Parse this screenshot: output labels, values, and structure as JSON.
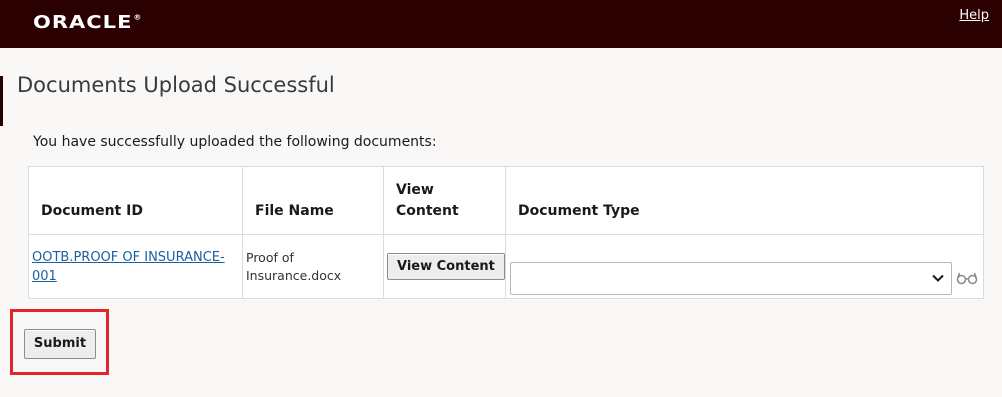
{
  "header": {
    "logo_text": "ORACLE",
    "logo_mark": "®",
    "help_label": "Help"
  },
  "page": {
    "title": "Documents Upload Successful",
    "intro": "You have successfully uploaded the following documents:"
  },
  "table": {
    "headers": {
      "document_id": "Document ID",
      "file_name": "File Name",
      "view_content_line1": "View",
      "view_content_line2": "Content",
      "document_type": "Document Type"
    },
    "rows": [
      {
        "document_id_line1": "OOTB.PROOF OF INSURANCE-",
        "document_id_line2": "001",
        "file_name_line1": "Proof of",
        "file_name_line2": "Insurance.docx",
        "view_button_label": "View Content",
        "document_type_value": ""
      }
    ]
  },
  "actions": {
    "submit_label": "Submit"
  },
  "colors": {
    "header_bg": "#2a0000",
    "link": "#1b5f9f",
    "highlight": "#e3262c"
  },
  "icons": {
    "dropdown": "chevron-down-icon",
    "lookup": "glasses-icon"
  }
}
